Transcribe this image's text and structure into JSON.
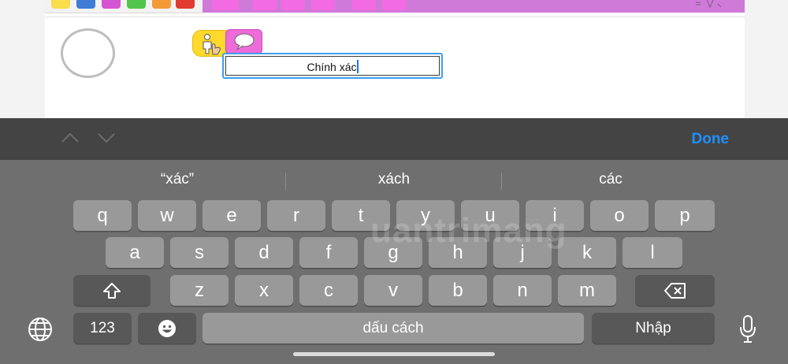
{
  "editor": {
    "text_field_value": "Chính xác",
    "palette_colors": [
      "#f7de4a",
      "#3e7cd6",
      "#d455d3",
      "#52c54d",
      "#f39a37",
      "#e23a2f"
    ],
    "strip_color": "#cf7ad8",
    "block_color": "#f36be2"
  },
  "accessory_bar": {
    "prev_icon": "chevron-up-icon",
    "next_icon": "chevron-down-icon",
    "done_label": "Done",
    "accent_color": "#1f8ffe"
  },
  "suggestions": [
    "“xác”",
    "xách",
    "các"
  ],
  "keyboard": {
    "row1": [
      "q",
      "w",
      "e",
      "r",
      "t",
      "y",
      "u",
      "i",
      "o",
      "p"
    ],
    "row2": [
      "a",
      "s",
      "d",
      "f",
      "g",
      "h",
      "j",
      "k",
      "l"
    ],
    "row3": [
      "z",
      "x",
      "c",
      "v",
      "b",
      "n",
      "m"
    ],
    "numbers_label": "123",
    "space_label": "dấu cách",
    "return_label": "Nhập",
    "shift_icon": "shift-icon",
    "delete_icon": "backspace-icon",
    "emoji_icon": "emoji-icon",
    "globe_icon": "globe-icon",
    "mic_icon": "microphone-icon"
  },
  "watermark": "uantrimang"
}
